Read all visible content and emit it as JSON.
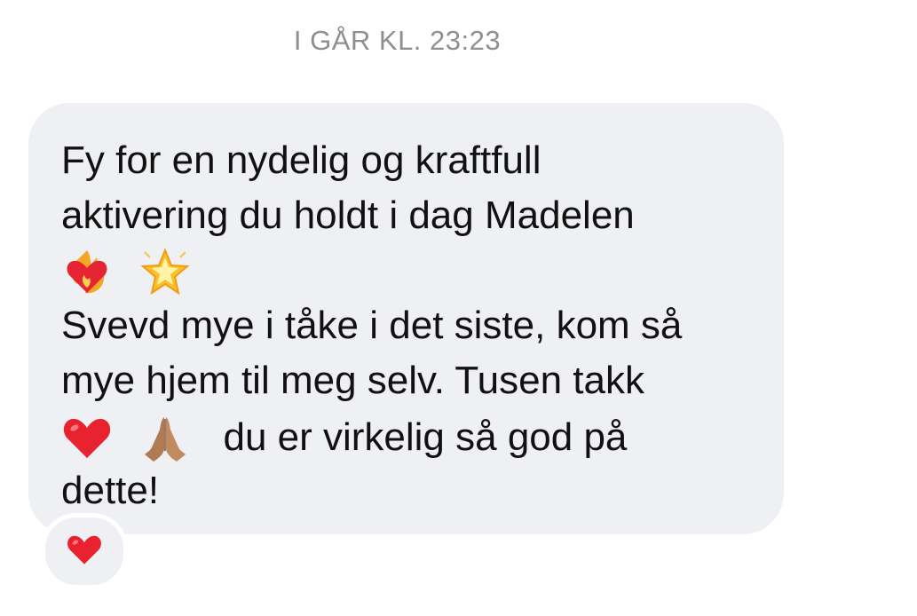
{
  "timestamp": "I GÅR KL. 23:23",
  "message": {
    "line1": "Fy for en nydelig og kraftfull",
    "line2": "aktivering du holdt i dag Madelen",
    "emoji_row": [
      "heart-on-fire-icon",
      "glowing-star-icon"
    ],
    "line4": "Svevd mye i tåke i det siste, kom så",
    "line5": "mye hjem til meg selv. Tusen takk",
    "emoji_row2": [
      "red-heart-icon",
      "folded-hands-icon"
    ],
    "line6_text": "du er virkelig så god på",
    "line7": "dette!"
  },
  "reaction": {
    "icon": "red-heart-icon"
  },
  "colors": {
    "bubble": "#eff0f3",
    "timestamp": "#8e8e93",
    "text": "#111111",
    "heart": "#e8222e"
  }
}
